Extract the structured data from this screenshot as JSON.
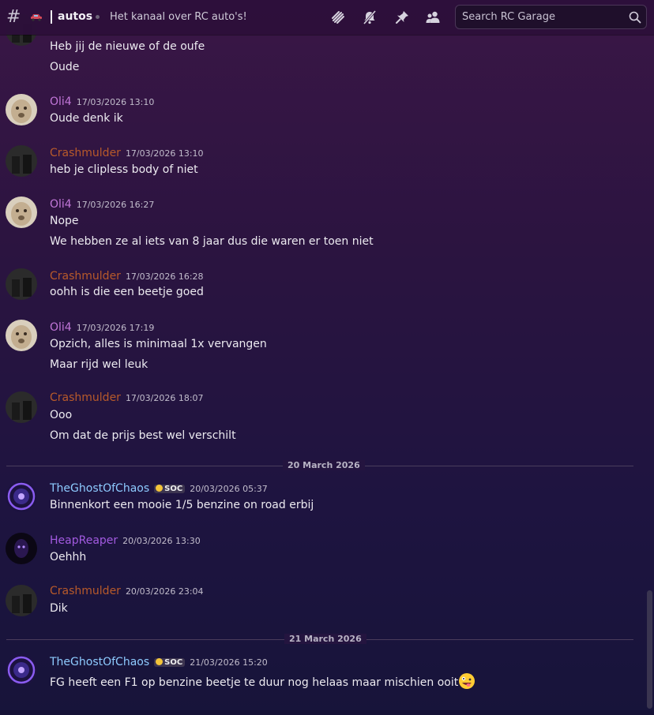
{
  "header": {
    "channel_icon": "hash-icon",
    "emoji_icon": "car-emoji-icon",
    "channel_name": "autos",
    "topic": "Het kanaal over RC auto's!",
    "tool_icons": [
      "threads-icon",
      "notifications-muted-icon",
      "pin-icon",
      "members-icon"
    ],
    "search_placeholder": "Search RC Garage"
  },
  "colors": {
    "oli4": "#c277d9",
    "crashmulder": "#b85a2a",
    "ghost": "#8ecbff",
    "heap": "#a25ae0"
  },
  "messages": [
    {
      "continuation": true,
      "lines": [
        "Heb jij de nieuwe of de oufe",
        "Oude"
      ]
    },
    {
      "author": "Oli4",
      "time": "17/03/2026 13:10",
      "lines": [
        "Oude denk ik"
      ]
    },
    {
      "author": "Crashmulder",
      "time": "17/03/2026 13:10",
      "lines": [
        "heb je clipless body of niet"
      ]
    },
    {
      "author": "Oli4",
      "time": "17/03/2026 16:27",
      "lines": [
        "Nope",
        "We hebben ze al iets van 8 jaar dus die waren er toen niet"
      ]
    },
    {
      "author": "Crashmulder",
      "time": "17/03/2026 16:28",
      "lines": [
        "oohh is die een beetje goed"
      ]
    },
    {
      "author": "Oli4",
      "time": "17/03/2026 17:19",
      "lines": [
        "Opzich, alles is minimaal 1x vervangen",
        "Maar rijd wel leuk"
      ]
    },
    {
      "author": "Crashmulder",
      "time": "17/03/2026 18:07",
      "lines": [
        "Ooo",
        "Om dat de prijs best wel verschilt"
      ]
    },
    {
      "author": "TheGhostOfChaos",
      "badge": "SOC",
      "time": "20/03/2026 05:37",
      "lines": [
        "Binnenkort een mooie 1/5 benzine on road erbij"
      ]
    },
    {
      "author": "HeapReaper",
      "time": "20/03/2026 13:30",
      "lines": [
        "Oehhh"
      ]
    },
    {
      "author": "Crashmulder",
      "time": "20/03/2026 23:04",
      "lines": [
        "Dik"
      ]
    },
    {
      "author": "TheGhostOfChaos",
      "badge": "SOC",
      "time": "21/03/2026 15:20",
      "lines": [
        "FG heeft een F1 op benzine beetje te duur nog helaas maar mischien ooit"
      ],
      "emoji": "zany-face-emoji-icon"
    }
  ],
  "dividers": [
    "20 March 2026",
    "21 March 2026"
  ]
}
